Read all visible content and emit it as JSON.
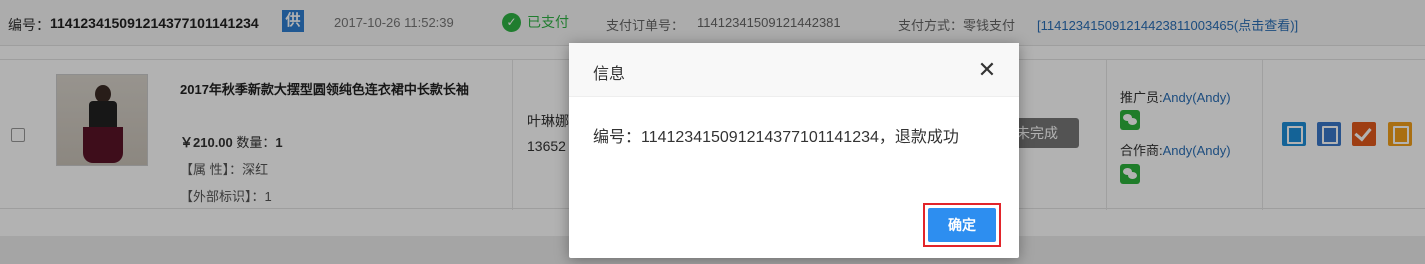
{
  "order": {
    "number_label": "编号：",
    "number": "114123415091214377101141234",
    "supply_badge": "供",
    "time": "2017-10-26 11:52:39",
    "paid_status": "已支付",
    "pay_order_label": "支付订单号：",
    "pay_order_no": "1141234150912144238​1",
    "pay_method": "支付方式：零钱支付",
    "pay_link": "[11412341509121442381​1003465(点击查看)]"
  },
  "product": {
    "title": "2017年秋季新款大摆型圆领纯色连衣裙中长款长袖",
    "price": "￥210.00",
    "qty_label": "数量：",
    "qty": "1",
    "attr": "【属 性】：深红",
    "ext": "【外部标识】：1"
  },
  "buyer": {
    "name": "叶琳娜",
    "phone": "13652"
  },
  "status_text": "未完成",
  "promoter": {
    "label": "推广员:",
    "name": "Andy(Andy)"
  },
  "partner": {
    "label": "合作商:",
    "name": "Andy(Andy)"
  },
  "dialog": {
    "title": "信息",
    "close_glyph": "✕",
    "message": "编号：114123415091214377101141234，退款成功",
    "ok_label": "确定"
  }
}
